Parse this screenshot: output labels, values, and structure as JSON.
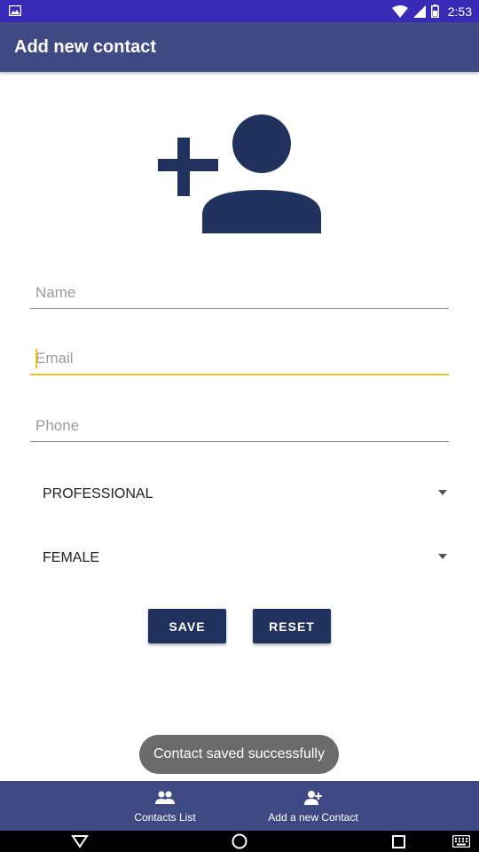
{
  "status_bar": {
    "time": "2:53",
    "icons": [
      "image-icon",
      "wifi-icon",
      "signal-icon",
      "battery-icon"
    ]
  },
  "app_bar": {
    "title": "Add new contact"
  },
  "hero": {
    "icon": "add-person-icon",
    "color": "#22325f"
  },
  "form": {
    "name": {
      "placeholder": "Name",
      "value": ""
    },
    "email": {
      "placeholder": "Email",
      "value": ""
    },
    "phone": {
      "placeholder": "Phone",
      "value": ""
    },
    "category": {
      "selected": "PROFESSIONAL"
    },
    "gender": {
      "selected": "FEMALE"
    }
  },
  "buttons": {
    "save": "SAVE",
    "reset": "RESET"
  },
  "toast": {
    "message": "Contact saved successfully"
  },
  "bottom_nav": {
    "items": [
      {
        "label": "Contacts List",
        "icon": "group-icon"
      },
      {
        "label": "Add a new Contact",
        "icon": "person-add-icon"
      }
    ]
  },
  "colors": {
    "primary": "#3f4a84",
    "button": "#22325f",
    "accent": "#f3c21b",
    "status_bar": "#3a2ab8"
  }
}
